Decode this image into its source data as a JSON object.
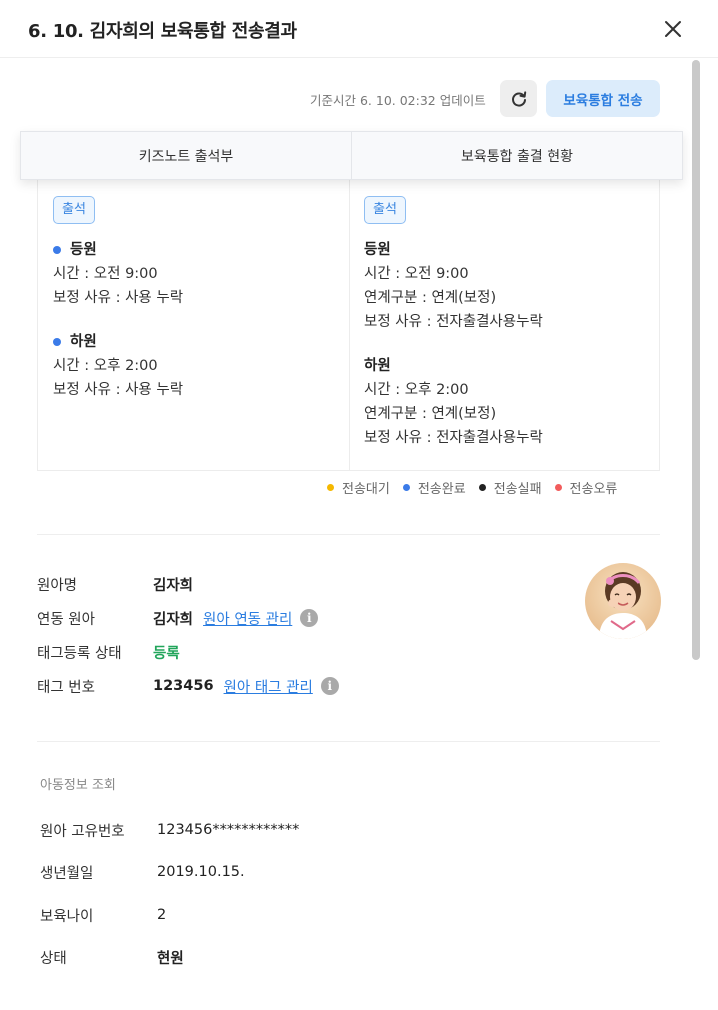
{
  "header": {
    "title": "6. 10. 김자희의 보육통합 전송결과",
    "close_icon": "close-icon"
  },
  "toolbar": {
    "update_text": "기준시간 6. 10. 02:32 업데이트",
    "refresh_icon": "refresh-icon",
    "send_label": "보육통합 전송"
  },
  "tabs": [
    {
      "label": "키즈노트 출석부"
    },
    {
      "label": "보육통합 출결 현황"
    }
  ],
  "kidsnote": {
    "badge": "출석",
    "entries": [
      {
        "title": "등원",
        "lines": [
          "시간 : 오전 9:00",
          "보정 사유 : 사용 누락"
        ]
      },
      {
        "title": "하원",
        "lines": [
          "시간 : 오후 2:00",
          "보정 사유 : 사용 누락"
        ]
      }
    ]
  },
  "integration": {
    "badge": "출석",
    "entries": [
      {
        "title": "등원",
        "lines": [
          "시간 : 오전 9:00",
          "연계구분 : 연계(보정)",
          "보정 사유 : 전자출결사용누락"
        ]
      },
      {
        "title": "하원",
        "lines": [
          "시간 : 오후 2:00",
          "연계구분 : 연계(보정)",
          "보정 사유 : 전자출결사용누락"
        ]
      }
    ]
  },
  "legend": [
    {
      "label": "전송대기",
      "color": "#f5b800"
    },
    {
      "label": "전송완료",
      "color": "#3b7be8"
    },
    {
      "label": "전송실패",
      "color": "#222222"
    },
    {
      "label": "전송오류",
      "color": "#f25c5c"
    }
  ],
  "child_info": {
    "name_label": "원아명",
    "name_value": "김자희",
    "linked_label": "연동 원아",
    "linked_value": "김자희",
    "linked_link": "원아 연동 관리",
    "tag_status_label": "태그등록 상태",
    "tag_status_value": "등록",
    "tag_number_label": "태그 번호",
    "tag_number_value": "123456",
    "tag_link": "원아 태그 관리",
    "info_icon": "i"
  },
  "child_detail": {
    "section_title": "아동정보 조회",
    "rows": [
      {
        "label": "원아 고유번호",
        "value": "123456************"
      },
      {
        "label": "생년월일",
        "value": "2019.10.15."
      },
      {
        "label": "보육나이",
        "value": "2"
      },
      {
        "label": "상태",
        "value": "현원"
      }
    ]
  },
  "colors": {
    "accent": "#2b7de0",
    "badge_border": "#8fbef2",
    "green": "#22a55b",
    "dot_blue": "#3b7be8"
  }
}
